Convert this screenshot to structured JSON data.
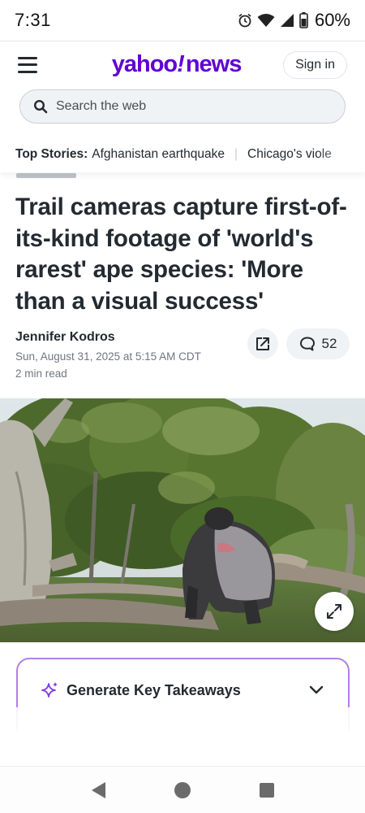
{
  "status_bar": {
    "time": "7:31",
    "battery": "60%",
    "icons": [
      "alarm-icon",
      "wifi-icon",
      "signal-icon",
      "battery-icon"
    ]
  },
  "header": {
    "logo": {
      "part1": "yahoo",
      "part2": "!",
      "part3": "news"
    },
    "menu_icon": "hamburger-menu-icon",
    "signin_label": "Sign in",
    "brand_color": "#6001d2"
  },
  "search": {
    "placeholder": "Search the web"
  },
  "top_stories": {
    "label": "Top Stories:",
    "items": [
      "Afghanistan earthquake",
      "Chicago's viole"
    ]
  },
  "article": {
    "headline": "Trail cameras capture first-of-its-kind footage of 'world's rarest' ape species: 'More than a visual success'",
    "author": "Jennifer Kodros",
    "date": "Sun, August 31, 2025 at 5:15 AM CDT",
    "read_time": "2 min read",
    "comment_count": "52"
  },
  "takeaways": {
    "label": "Generate Key Takeaways",
    "accent_color": "#b37fea"
  }
}
